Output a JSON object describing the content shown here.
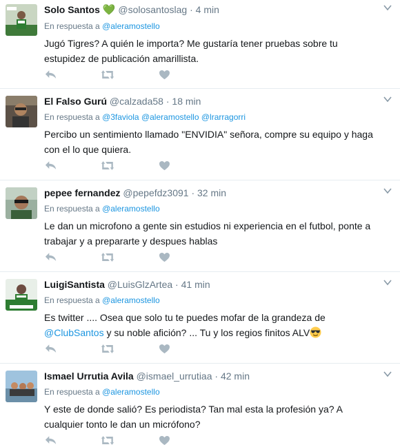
{
  "tweets": [
    {
      "name": "Solo Santos",
      "badge": "💚",
      "handle": "@solosantoslag",
      "sep": "·",
      "time": "4 min",
      "reply_prefix": "En respuesta a",
      "reply_to": [
        "@aleramostello"
      ],
      "text": "Jugó Tigres? A quién le importa? Me gustaría tener pruebas sobre tu estupidez de publicación amarillista."
    },
    {
      "name": "El Falso Gurú",
      "handle": "@calzada58",
      "sep": "·",
      "time": "18 min",
      "reply_prefix": "En respuesta a",
      "reply_to": [
        "@3faviola",
        "@aleramostello",
        "@lrarragorri"
      ],
      "text": "Percibo un sentimiento llamado \"ENVIDIA\" señora, compre su equipo y haga con el lo que quiera."
    },
    {
      "name": "pepee fernandez",
      "handle": "@pepefdz3091",
      "sep": "·",
      "time": "32 min",
      "reply_prefix": "En respuesta a",
      "reply_to": [
        "@aleramostello"
      ],
      "text": "Le dan un microfono a gente sin estudios ni experiencia en el futbol, ponte a trabajar y a prepararte y despues hablas"
    },
    {
      "name": "LuigiSantista",
      "handle": "@LuisGlzArtea",
      "sep": "·",
      "time": "41 min",
      "reply_prefix": "En respuesta a",
      "reply_to": [
        "@aleramostello"
      ],
      "text_a": "Es twitter  .... Osea que solo tu te puedes mofar de la grandeza de",
      "text_mention": "@ClubSantos",
      "text_b": "y su noble afición? ... Tu y los regios finitos ALV"
    },
    {
      "name": "Ismael Urrutia Avila",
      "handle": "@ismael_urrutiaa",
      "sep": "·",
      "time": "42 min",
      "reply_prefix": "En respuesta a",
      "reply_to": [
        "@aleramostello"
      ],
      "text": "Y este de donde salió? Es periodista? Tan mal esta la profesión ya? A cualquier tonto le dan un micrófono?"
    }
  ],
  "icons": {
    "reply": "reply-icon",
    "retweet": "retweet-icon",
    "like": "heart-icon",
    "more": "caret-down-icon",
    "emoji": "sunglasses-emoji-icon"
  },
  "colors": {
    "link": "#1b95e0",
    "meta": "#657786",
    "icon": "#aab8c2",
    "divider": "#e6ecf0",
    "badge": "#6abf4b"
  }
}
